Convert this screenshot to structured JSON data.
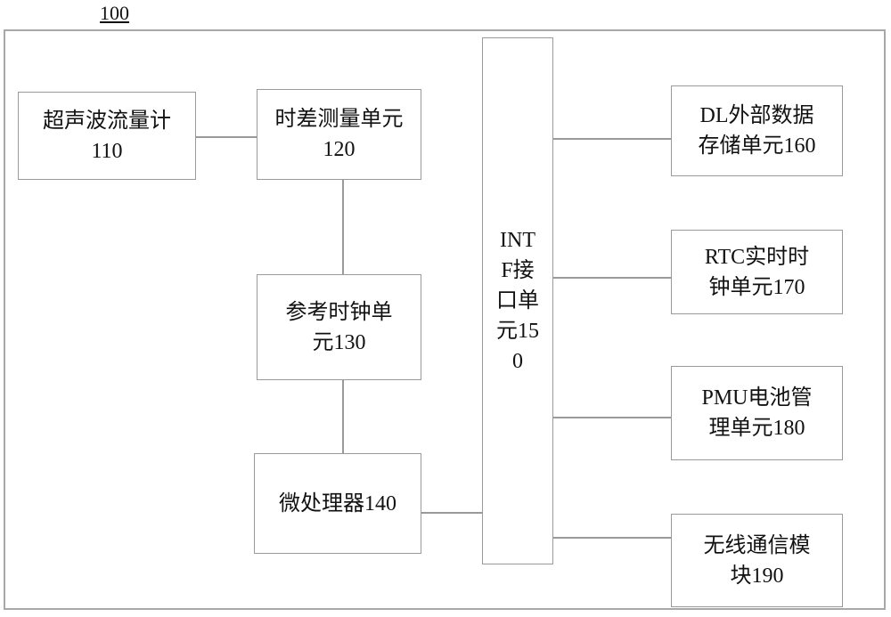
{
  "diagram": {
    "title": "100",
    "blocks": [
      {
        "id": "110",
        "label": "超声波流量计\n110"
      },
      {
        "id": "120",
        "label": "时差测量单元\n120"
      },
      {
        "id": "130",
        "label": "参考时钟单\n元130"
      },
      {
        "id": "140",
        "label": "微处理器140"
      },
      {
        "id": "150",
        "label": "INT\nF接\n口单\n元15\n0"
      },
      {
        "id": "160",
        "label": "DL外部数据\n存储单元160"
      },
      {
        "id": "170",
        "label": "RTC实时时\n钟单元170"
      },
      {
        "id": "180",
        "label": "PMU电池管\n理单元180"
      },
      {
        "id": "190",
        "label": "无线通信模\n块190"
      }
    ],
    "connections": [
      [
        "110",
        "120"
      ],
      [
        "120",
        "130"
      ],
      [
        "130",
        "140"
      ],
      [
        "140",
        "150"
      ],
      [
        "150",
        "160"
      ],
      [
        "150",
        "170"
      ],
      [
        "150",
        "180"
      ],
      [
        "150",
        "190"
      ]
    ]
  }
}
